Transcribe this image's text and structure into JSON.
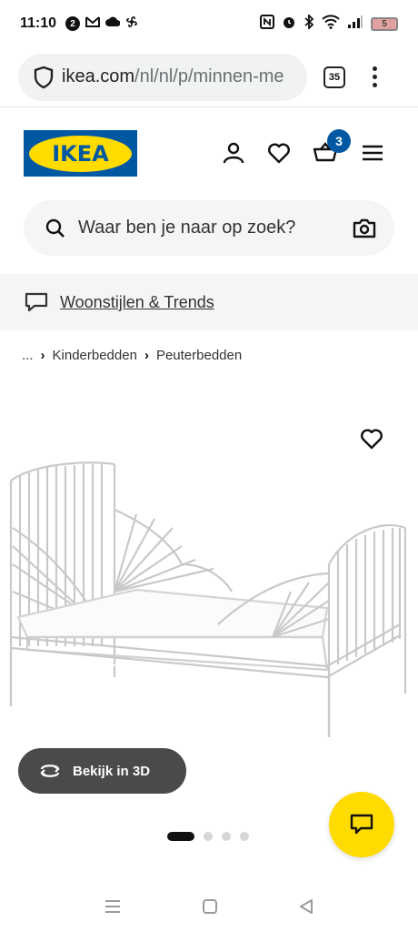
{
  "status_bar": {
    "time": "11:10",
    "notification_count": "2",
    "battery_level": "5"
  },
  "browser": {
    "url_host": "ikea.com",
    "url_path": "/nl/nl/p/minnen-me",
    "tab_count": "35"
  },
  "header": {
    "logo_text": "IKEA",
    "cart_count": "3"
  },
  "search": {
    "placeholder": "Waar ben je naar op zoek?"
  },
  "inspiration": {
    "link_label": "Woonstijlen & Trends"
  },
  "breadcrumb": {
    "ellipsis": "...",
    "items": [
      "Kinderbedden",
      "Peuterbedden"
    ]
  },
  "product": {
    "view_3d_label": "Bekijk in 3D",
    "image_count": 4,
    "active_image": 1
  },
  "colors": {
    "ikea_blue": "#0058a3",
    "ikea_yellow": "#ffdb00",
    "dark_button": "#4a4a4a"
  }
}
